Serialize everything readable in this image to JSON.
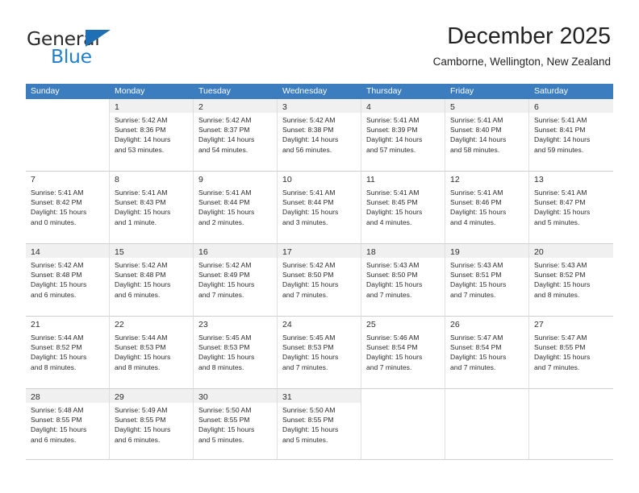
{
  "logo": {
    "primary_text": "General",
    "secondary_text": "Blue",
    "flag_color": "#1f6fb5",
    "secondary_color": "#1f7fd0"
  },
  "header": {
    "title": "December 2025",
    "subtitle": "Camborne, Wellington, New Zealand"
  },
  "theme": {
    "header_bar_color": "#3b7dbf",
    "shaded_row_color": "#f0f0f0",
    "text_color": "#2b2b2b",
    "grid_line_color": "#dfdfdf"
  },
  "calendar": {
    "day_headers": [
      "Sunday",
      "Monday",
      "Tuesday",
      "Wednesday",
      "Thursday",
      "Friday",
      "Saturday"
    ],
    "weeks": [
      {
        "shaded": true,
        "days": [
          {
            "number": "",
            "sunrise": "",
            "sunset": "",
            "daylight_line1": "",
            "daylight_line2": ""
          },
          {
            "number": "1",
            "sunrise": "Sunrise: 5:42 AM",
            "sunset": "Sunset: 8:36 PM",
            "daylight_line1": "Daylight: 14 hours",
            "daylight_line2": "and 53 minutes."
          },
          {
            "number": "2",
            "sunrise": "Sunrise: 5:42 AM",
            "sunset": "Sunset: 8:37 PM",
            "daylight_line1": "Daylight: 14 hours",
            "daylight_line2": "and 54 minutes."
          },
          {
            "number": "3",
            "sunrise": "Sunrise: 5:42 AM",
            "sunset": "Sunset: 8:38 PM",
            "daylight_line1": "Daylight: 14 hours",
            "daylight_line2": "and 56 minutes."
          },
          {
            "number": "4",
            "sunrise": "Sunrise: 5:41 AM",
            "sunset": "Sunset: 8:39 PM",
            "daylight_line1": "Daylight: 14 hours",
            "daylight_line2": "and 57 minutes."
          },
          {
            "number": "5",
            "sunrise": "Sunrise: 5:41 AM",
            "sunset": "Sunset: 8:40 PM",
            "daylight_line1": "Daylight: 14 hours",
            "daylight_line2": "and 58 minutes."
          },
          {
            "number": "6",
            "sunrise": "Sunrise: 5:41 AM",
            "sunset": "Sunset: 8:41 PM",
            "daylight_line1": "Daylight: 14 hours",
            "daylight_line2": "and 59 minutes."
          }
        ]
      },
      {
        "shaded": false,
        "days": [
          {
            "number": "7",
            "sunrise": "Sunrise: 5:41 AM",
            "sunset": "Sunset: 8:42 PM",
            "daylight_line1": "Daylight: 15 hours",
            "daylight_line2": "and 0 minutes."
          },
          {
            "number": "8",
            "sunrise": "Sunrise: 5:41 AM",
            "sunset": "Sunset: 8:43 PM",
            "daylight_line1": "Daylight: 15 hours",
            "daylight_line2": "and 1 minute."
          },
          {
            "number": "9",
            "sunrise": "Sunrise: 5:41 AM",
            "sunset": "Sunset: 8:44 PM",
            "daylight_line1": "Daylight: 15 hours",
            "daylight_line2": "and 2 minutes."
          },
          {
            "number": "10",
            "sunrise": "Sunrise: 5:41 AM",
            "sunset": "Sunset: 8:44 PM",
            "daylight_line1": "Daylight: 15 hours",
            "daylight_line2": "and 3 minutes."
          },
          {
            "number": "11",
            "sunrise": "Sunrise: 5:41 AM",
            "sunset": "Sunset: 8:45 PM",
            "daylight_line1": "Daylight: 15 hours",
            "daylight_line2": "and 4 minutes."
          },
          {
            "number": "12",
            "sunrise": "Sunrise: 5:41 AM",
            "sunset": "Sunset: 8:46 PM",
            "daylight_line1": "Daylight: 15 hours",
            "daylight_line2": "and 4 minutes."
          },
          {
            "number": "13",
            "sunrise": "Sunrise: 5:41 AM",
            "sunset": "Sunset: 8:47 PM",
            "daylight_line1": "Daylight: 15 hours",
            "daylight_line2": "and 5 minutes."
          }
        ]
      },
      {
        "shaded": true,
        "days": [
          {
            "number": "14",
            "sunrise": "Sunrise: 5:42 AM",
            "sunset": "Sunset: 8:48 PM",
            "daylight_line1": "Daylight: 15 hours",
            "daylight_line2": "and 6 minutes."
          },
          {
            "number": "15",
            "sunrise": "Sunrise: 5:42 AM",
            "sunset": "Sunset: 8:48 PM",
            "daylight_line1": "Daylight: 15 hours",
            "daylight_line2": "and 6 minutes."
          },
          {
            "number": "16",
            "sunrise": "Sunrise: 5:42 AM",
            "sunset": "Sunset: 8:49 PM",
            "daylight_line1": "Daylight: 15 hours",
            "daylight_line2": "and 7 minutes."
          },
          {
            "number": "17",
            "sunrise": "Sunrise: 5:42 AM",
            "sunset": "Sunset: 8:50 PM",
            "daylight_line1": "Daylight: 15 hours",
            "daylight_line2": "and 7 minutes."
          },
          {
            "number": "18",
            "sunrise": "Sunrise: 5:43 AM",
            "sunset": "Sunset: 8:50 PM",
            "daylight_line1": "Daylight: 15 hours",
            "daylight_line2": "and 7 minutes."
          },
          {
            "number": "19",
            "sunrise": "Sunrise: 5:43 AM",
            "sunset": "Sunset: 8:51 PM",
            "daylight_line1": "Daylight: 15 hours",
            "daylight_line2": "and 7 minutes."
          },
          {
            "number": "20",
            "sunrise": "Sunrise: 5:43 AM",
            "sunset": "Sunset: 8:52 PM",
            "daylight_line1": "Daylight: 15 hours",
            "daylight_line2": "and 8 minutes."
          }
        ]
      },
      {
        "shaded": false,
        "days": [
          {
            "number": "21",
            "sunrise": "Sunrise: 5:44 AM",
            "sunset": "Sunset: 8:52 PM",
            "daylight_line1": "Daylight: 15 hours",
            "daylight_line2": "and 8 minutes."
          },
          {
            "number": "22",
            "sunrise": "Sunrise: 5:44 AM",
            "sunset": "Sunset: 8:53 PM",
            "daylight_line1": "Daylight: 15 hours",
            "daylight_line2": "and 8 minutes."
          },
          {
            "number": "23",
            "sunrise": "Sunrise: 5:45 AM",
            "sunset": "Sunset: 8:53 PM",
            "daylight_line1": "Daylight: 15 hours",
            "daylight_line2": "and 8 minutes."
          },
          {
            "number": "24",
            "sunrise": "Sunrise: 5:45 AM",
            "sunset": "Sunset: 8:53 PM",
            "daylight_line1": "Daylight: 15 hours",
            "daylight_line2": "and 7 minutes."
          },
          {
            "number": "25",
            "sunrise": "Sunrise: 5:46 AM",
            "sunset": "Sunset: 8:54 PM",
            "daylight_line1": "Daylight: 15 hours",
            "daylight_line2": "and 7 minutes."
          },
          {
            "number": "26",
            "sunrise": "Sunrise: 5:47 AM",
            "sunset": "Sunset: 8:54 PM",
            "daylight_line1": "Daylight: 15 hours",
            "daylight_line2": "and 7 minutes."
          },
          {
            "number": "27",
            "sunrise": "Sunrise: 5:47 AM",
            "sunset": "Sunset: 8:55 PM",
            "daylight_line1": "Daylight: 15 hours",
            "daylight_line2": "and 7 minutes."
          }
        ]
      },
      {
        "shaded": true,
        "days": [
          {
            "number": "28",
            "sunrise": "Sunrise: 5:48 AM",
            "sunset": "Sunset: 8:55 PM",
            "daylight_line1": "Daylight: 15 hours",
            "daylight_line2": "and 6 minutes."
          },
          {
            "number": "29",
            "sunrise": "Sunrise: 5:49 AM",
            "sunset": "Sunset: 8:55 PM",
            "daylight_line1": "Daylight: 15 hours",
            "daylight_line2": "and 6 minutes."
          },
          {
            "number": "30",
            "sunrise": "Sunrise: 5:50 AM",
            "sunset": "Sunset: 8:55 PM",
            "daylight_line1": "Daylight: 15 hours",
            "daylight_line2": "and 5 minutes."
          },
          {
            "number": "31",
            "sunrise": "Sunrise: 5:50 AM",
            "sunset": "Sunset: 8:55 PM",
            "daylight_line1": "Daylight: 15 hours",
            "daylight_line2": "and 5 minutes."
          },
          {
            "number": "",
            "sunrise": "",
            "sunset": "",
            "daylight_line1": "",
            "daylight_line2": ""
          },
          {
            "number": "",
            "sunrise": "",
            "sunset": "",
            "daylight_line1": "",
            "daylight_line2": ""
          },
          {
            "number": "",
            "sunrise": "",
            "sunset": "",
            "daylight_line1": "",
            "daylight_line2": ""
          }
        ]
      }
    ]
  }
}
